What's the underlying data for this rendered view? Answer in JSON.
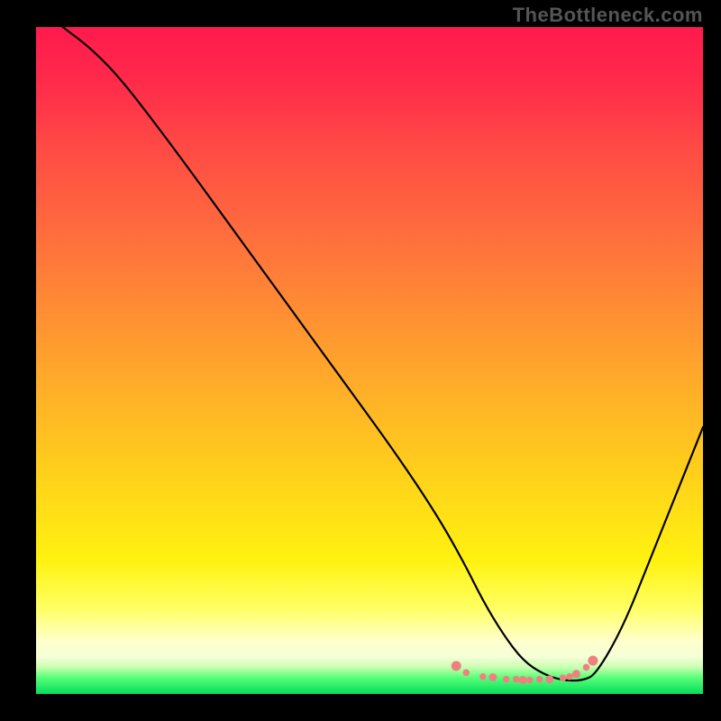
{
  "watermark": "TheBottleneck.com",
  "chart_data": {
    "type": "line",
    "title": "",
    "xlabel": "",
    "ylabel": "",
    "xlim": [
      0,
      100
    ],
    "ylim": [
      0,
      100
    ],
    "series": [
      {
        "name": "curve",
        "x": [
          4,
          8,
          12,
          16,
          22,
          30,
          38,
          46,
          54,
          60,
          64,
          67,
          70,
          73,
          76,
          79,
          82,
          84,
          88,
          92,
          96,
          100
        ],
        "y": [
          100,
          97,
          93,
          88,
          80,
          69,
          58,
          47,
          36,
          27,
          20,
          14,
          9,
          5,
          3,
          2,
          2,
          3,
          10,
          20,
          30,
          40
        ]
      }
    ],
    "markers": {
      "name": "bottom-dots",
      "color": "#f08080",
      "x": [
        63,
        64.5,
        67,
        68.5,
        70.5,
        72,
        73,
        74,
        75.5,
        77,
        79,
        80,
        81,
        82.5,
        83.5
      ],
      "y": [
        4.2,
        3.2,
        2.6,
        2.5,
        2.2,
        2.2,
        2.1,
        2.1,
        2.2,
        2.2,
        2.4,
        2.6,
        3.0,
        4.0,
        5.0
      ]
    },
    "gradient_stops": [
      {
        "pos": 0.0,
        "color": "#ff1a4d"
      },
      {
        "pos": 0.3,
        "color": "#ff6a3e"
      },
      {
        "pos": 0.68,
        "color": "#ffd31a"
      },
      {
        "pos": 0.92,
        "color": "#ffffcc"
      },
      {
        "pos": 0.97,
        "color": "#5aff7a"
      },
      {
        "pos": 1.0,
        "color": "#04dd5a"
      }
    ]
  }
}
